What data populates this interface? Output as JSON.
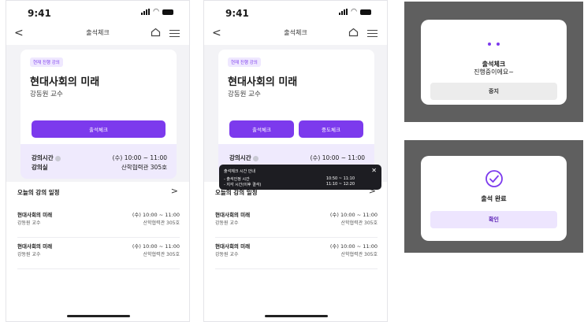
{
  "status_time": "9:41",
  "header": {
    "back": "<",
    "title": "출석체크"
  },
  "course": {
    "badge": "현재 진행 강의",
    "title": "현대사회의 미래",
    "professor": "강동원 교수",
    "checkin_label": "출석체크",
    "midcheck_label": "중도체크",
    "time_label": "강의시간",
    "time_value": "(수) 10:00 ~ 11:00",
    "room_label": "강의실",
    "room_value": "산학협력관 305호"
  },
  "schedule": {
    "title": "오늘의 강의 일정",
    "chevron": ">",
    "items": [
      {
        "name": "현대사회의 미래",
        "prof": "강동원 교수",
        "time": "(수) 10:00 ~ 11:00",
        "room": "산학협력관 305호"
      },
      {
        "name": "현대사회의 미래",
        "prof": "강동원 교수",
        "time": "(수) 10:00 ~ 11:00",
        "room": "산학협력관 305호"
      }
    ]
  },
  "tooltip": {
    "title": "출석체크 시간 안내",
    "close": "✕",
    "rows": [
      {
        "label": "- 출석인정 시간",
        "value": "10:50 ~ 11:10"
      },
      {
        "label": "- 지각 시간(이후 결석)",
        "value": "11:10 ~ 12:20"
      }
    ]
  },
  "modal_progress": {
    "line1": "출석체크",
    "line2": "진행중이에요~",
    "button": "중지"
  },
  "modal_done": {
    "title": "출석 완료",
    "button": "확인"
  },
  "colors": {
    "accent": "#7c3aed",
    "accent_light": "#efeafd",
    "overlay": "#5f5f5f"
  },
  "icons": [
    "back-chevron-icon",
    "home-icon",
    "menu-icon",
    "info-icon",
    "close-icon",
    "check-circle-icon",
    "loading-dots-icon"
  ]
}
